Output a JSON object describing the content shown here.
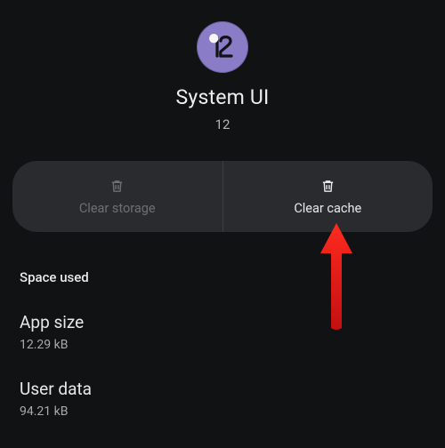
{
  "header": {
    "icon_name": "app-icon-android-12",
    "title": "System UI",
    "version": "12"
  },
  "actions": {
    "clear_storage_label": "Clear storage",
    "clear_cache_label": "Clear cache"
  },
  "space_used": {
    "header": "Space used",
    "app_size_label": "App size",
    "app_size_value": "12.29 kB",
    "user_data_label": "User data",
    "user_data_value": "94.21 kB"
  },
  "annotation": {
    "arrow_color": "#ff2a1f"
  }
}
